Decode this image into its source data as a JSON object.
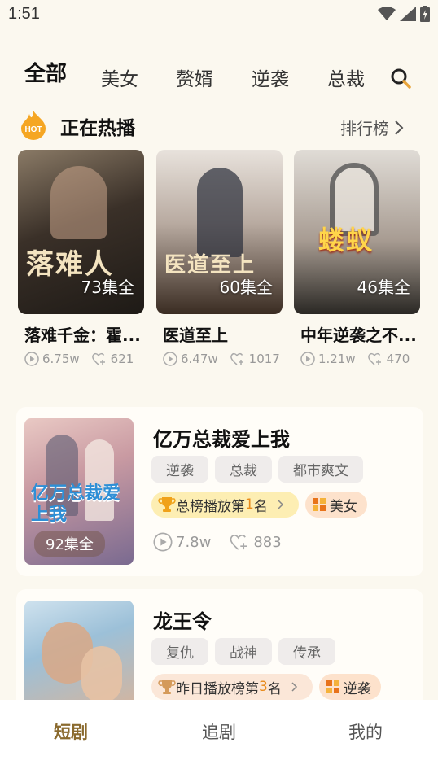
{
  "status": {
    "time": "1:51"
  },
  "tabs": [
    {
      "label": "全部",
      "active": true
    },
    {
      "label": "美女"
    },
    {
      "label": "赘婿"
    },
    {
      "label": "逆袭"
    },
    {
      "label": "总裁"
    }
  ],
  "hot": {
    "badge": "HOT",
    "title": "正在热播",
    "rank_link": "排行榜"
  },
  "hot_cards": [
    {
      "episodes": "73集全",
      "title": "落难千金：霍...",
      "plays": "6.75w",
      "likes": "621",
      "poster_text": "落难人"
    },
    {
      "episodes": "60集全",
      "title": "医道至上",
      "plays": "6.47w",
      "likes": "1017",
      "poster_text": "医道至上"
    },
    {
      "episodes": "46集全",
      "title": "中年逆袭之不...",
      "plays": "1.21w",
      "likes": "470",
      "poster_text": "蝼蚁"
    }
  ],
  "dramas": [
    {
      "title": "亿万总裁爱上我",
      "tags": [
        "逆袭",
        "总裁",
        "都市爽文"
      ],
      "rank_prefix": "总榜播放第",
      "rank_num": "1",
      "rank_suffix": "名",
      "category": "美女",
      "episodes": "92集全",
      "plays": "7.8w",
      "likes": "883",
      "poster_text": "亿万总裁爱上我"
    },
    {
      "title": "龙王令",
      "tags": [
        "复仇",
        "战神",
        "传承"
      ],
      "rank_prefix": "昨日播放榜第",
      "rank_num": "3",
      "rank_suffix": "名",
      "category": "逆袭"
    }
  ],
  "nav": [
    {
      "label": "短剧",
      "active": true
    },
    {
      "label": "追剧"
    },
    {
      "label": "我的"
    }
  ],
  "colors": {
    "accent": "#8a6a2e",
    "highlight": "#e88a1a",
    "background": "#fbf8ef"
  }
}
